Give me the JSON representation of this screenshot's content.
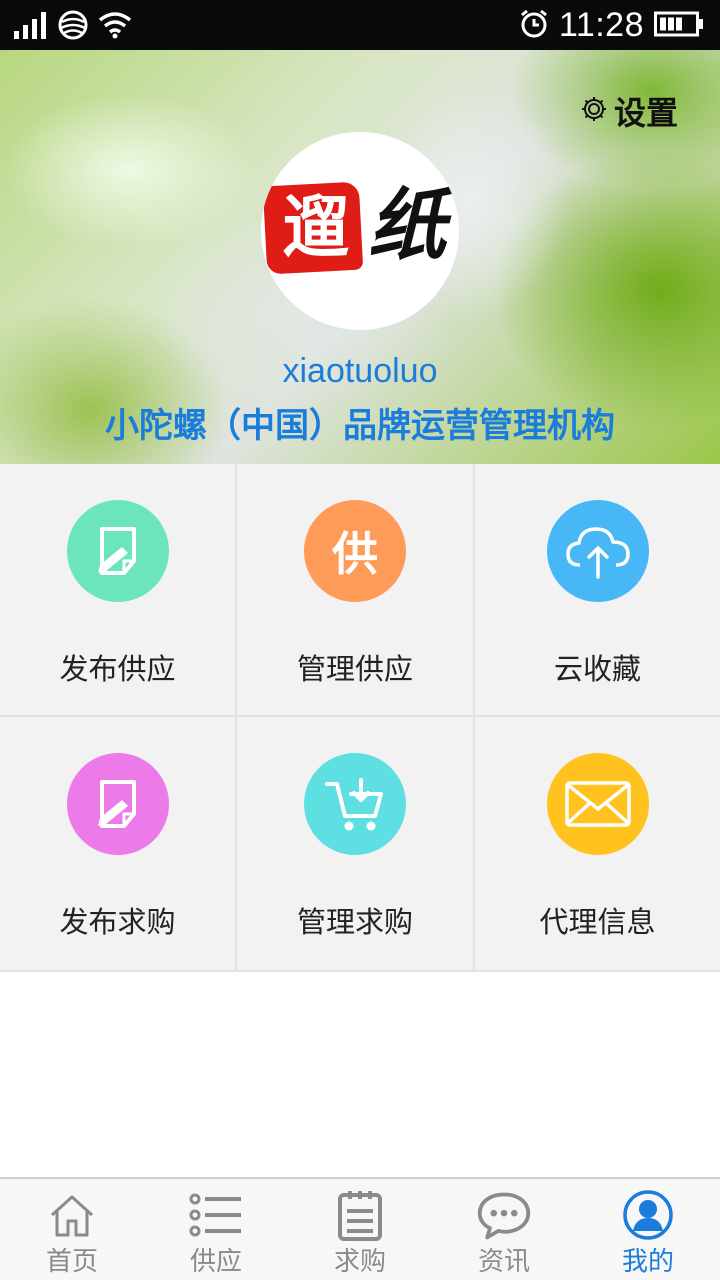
{
  "status_bar": {
    "time": "11:28",
    "signal_icon": "signal-icon",
    "network_icon": "network-icon",
    "wifi_icon": "wifi-icon",
    "alarm_icon": "alarm-icon",
    "battery_icon": "battery-icon"
  },
  "header": {
    "settings_label": "设置",
    "logo_chars": [
      "遛",
      "纸"
    ],
    "username": "xiaotuoluo",
    "organization": "小陀螺（中国）品牌运营管理机构"
  },
  "grid": {
    "items": [
      {
        "label": "发布供应",
        "icon": "publish-supply-icon",
        "color": "#6de5ba"
      },
      {
        "label": "管理供应",
        "icon": "manage-supply-icon",
        "color": "#ff9b58",
        "glyph": "供"
      },
      {
        "label": "云收藏",
        "icon": "cloud-upload-icon",
        "color": "#47b8f5"
      },
      {
        "label": "发布求购",
        "icon": "publish-request-icon",
        "color": "#ec7ae8"
      },
      {
        "label": "管理求购",
        "icon": "cart-icon",
        "color": "#5edfe2"
      },
      {
        "label": "代理信息",
        "icon": "mail-icon",
        "color": "#ffc21f"
      }
    ]
  },
  "tabbar": {
    "items": [
      {
        "label": "首页",
        "icon": "home-icon"
      },
      {
        "label": "供应",
        "icon": "list-icon"
      },
      {
        "label": "求购",
        "icon": "clipboard-icon"
      },
      {
        "label": "资讯",
        "icon": "chat-icon"
      },
      {
        "label": "我的",
        "icon": "user-icon",
        "active": true
      }
    ],
    "active_color": "#1a7ddc"
  }
}
